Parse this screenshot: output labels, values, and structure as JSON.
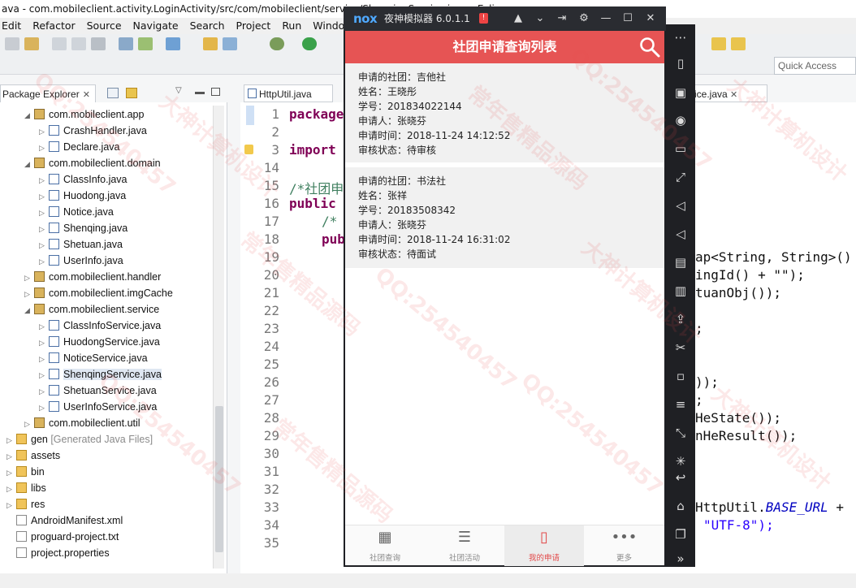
{
  "window_title": "ava - com.mobileclient.activity.LoginActivity/src/com/mobileclient/service/ShenqingService.java - Eclipse",
  "menu": [
    "Edit",
    "Refactor",
    "Source",
    "Navigate",
    "Search",
    "Project",
    "Run",
    "Window"
  ],
  "quick_access": "Quick Access",
  "package_explorer": {
    "tab_label": "Package Explorer",
    "close": "✕",
    "rows": [
      {
        "label": "com.mobileclient.app",
        "kind": "pkg",
        "level": 1,
        "expanded": true
      },
      {
        "label": "CrashHandler.java",
        "kind": "java",
        "level": 2
      },
      {
        "label": "Declare.java",
        "kind": "java",
        "level": 2
      },
      {
        "label": "com.mobileclient.domain",
        "kind": "pkg",
        "level": 1,
        "expanded": true
      },
      {
        "label": "ClassInfo.java",
        "kind": "java",
        "level": 2
      },
      {
        "label": "Huodong.java",
        "kind": "java",
        "level": 2
      },
      {
        "label": "Notice.java",
        "kind": "java",
        "level": 2
      },
      {
        "label": "Shenqing.java",
        "kind": "java",
        "level": 2
      },
      {
        "label": "Shetuan.java",
        "kind": "java",
        "level": 2
      },
      {
        "label": "UserInfo.java",
        "kind": "java",
        "level": 2
      },
      {
        "label": "com.mobileclient.handler",
        "kind": "pkg",
        "level": 1
      },
      {
        "label": "com.mobileclient.imgCache",
        "kind": "pkg",
        "level": 1
      },
      {
        "label": "com.mobileclient.service",
        "kind": "pkg",
        "level": 1,
        "expanded": true
      },
      {
        "label": "ClassInfoService.java",
        "kind": "java",
        "level": 2
      },
      {
        "label": "HuodongService.java",
        "kind": "java",
        "level": 2
      },
      {
        "label": "NoticeService.java",
        "kind": "java",
        "level": 2
      },
      {
        "label": "ShenqingService.java",
        "kind": "java",
        "level": 2,
        "selected": true
      },
      {
        "label": "ShetuanService.java",
        "kind": "java",
        "level": 2
      },
      {
        "label": "UserInfoService.java",
        "kind": "java",
        "level": 2
      },
      {
        "label": "com.mobileclient.util",
        "kind": "pkg",
        "level": 1
      },
      {
        "label": "gen",
        "extra": "[Generated Java Files]",
        "kind": "folder",
        "level": 0
      },
      {
        "label": "assets",
        "kind": "folder",
        "level": 0
      },
      {
        "label": "bin",
        "kind": "folder",
        "level": 0
      },
      {
        "label": "libs",
        "kind": "folder",
        "level": 0
      },
      {
        "label": "res",
        "kind": "folder",
        "level": 0
      },
      {
        "label": "AndroidManifest.xml",
        "kind": "file",
        "level": 0
      },
      {
        "label": "proguard-project.txt",
        "kind": "file",
        "level": 0
      },
      {
        "label": "project.properties",
        "kind": "file",
        "level": 0
      }
    ]
  },
  "editor": {
    "tab1": "HttpUtil.java",
    "tab2": "ice.java",
    "tab2_close": "✕",
    "line_numbers": [
      "1",
      "2",
      "3",
      "14",
      "15",
      "16",
      "17",
      "18",
      "19",
      "20",
      "21",
      "22",
      "23",
      "24",
      "25",
      "26",
      "27",
      "28",
      "29",
      "30",
      "31",
      "32",
      "33",
      "34",
      "35"
    ],
    "left_code": {
      "l1": "package",
      "l3": "import",
      "l15": "/*社团申",
      "l16": "public",
      "l17": "/*",
      "l18": "pub"
    },
    "right_code": {
      "r1": "ap<String, String>()",
      "r2": "ingId() + \"\");",
      "r3": "tuanObj());",
      "r4": ";",
      "r5": "));",
      "r6": ";",
      "r7": "HeState());",
      "r8": "nHeResult());",
      "r9a": "HttpUtil.",
      "r9b": "BASE_URL",
      "r9c": " +",
      "r10": "\"UTF-8\");"
    }
  },
  "nox": {
    "logo": "nox",
    "name": "夜神模拟器 6.0.1.1",
    "badge": "!",
    "app_title": "社团申请查询列表",
    "applications": [
      {
        "society": "申请的社团：吉他社",
        "name": "姓名：王晓彤",
        "student_no": "学号：201834022144",
        "applicant": "申请人：张晓芬",
        "time": "申请时间：2018-11-24 14:12:52",
        "status": "审核状态：待审核"
      },
      {
        "society": "申请的社团：书法社",
        "name": "姓名：张祥",
        "student_no": "学号：20183508342",
        "applicant": "申请人：张晓芬",
        "time": "申请时间：2018-11-24 16:31:02",
        "status": "审核状态：待面试"
      }
    ],
    "tabs": [
      {
        "icon": "▦",
        "label": "社团查询"
      },
      {
        "icon": "☰",
        "label": "社团活动"
      },
      {
        "icon": "▯",
        "label": "我的申请"
      },
      {
        "icon": "•••",
        "label": "更多"
      }
    ],
    "accent": "#e65454"
  },
  "watermarks": [
    "QQ:254540457",
    "大神计算机设计",
    "常年售精品源码",
    "QQ:254540457",
    "大神计算机设计",
    "常年售精品源码",
    "QQ:254540457",
    "大神计算机设计",
    "QQ:254540457",
    "常年售精品源码",
    "QQ:254540457",
    "大神计算机设计"
  ]
}
